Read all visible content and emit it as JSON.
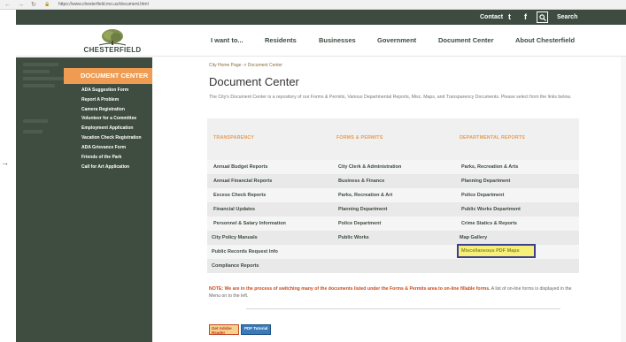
{
  "browser": {
    "back": "←",
    "forward": "→",
    "refresh": "↻",
    "lock": "🔒",
    "url": "https://www.chesterfield.mo.us/document.html"
  },
  "topbar": {
    "contact": "Contact",
    "twitter": "t",
    "facebook": "f",
    "search_label": "Search"
  },
  "site": {
    "logo_text": "CHESTERFIELD",
    "nav": [
      "I want to...",
      "Residents",
      "Businesses",
      "Government",
      "Document Center",
      "About Chesterfield"
    ]
  },
  "sidebar": {
    "title": "DOCUMENT CENTER",
    "items": [
      "ADA Suggestion Form",
      "Report A Problem",
      "Camera Registration",
      "Volunteer for a Committee",
      "Employment Application",
      "Vacation Check Registration",
      "ADA Grievance Form",
      "Friends of the Park",
      "Call for Art Application"
    ]
  },
  "main": {
    "breadcrumb_home": "City Home Page",
    "breadcrumb_sep": " -> ",
    "breadcrumb_current": "Document Center",
    "title": "Document Center",
    "intro": "The City's Document Center is a repository of our Forms & Permits, Various Departmental Reports, Misc. Maps, and Transparency Documents. Please select from the links below.",
    "columns": [
      {
        "heading": "TRANSPARENCY",
        "links": [
          "Annual Budget Reports",
          "Annual Financial Reports",
          "Excess Check Reports",
          "Financial Updates",
          "Personnel & Salary Information",
          "City Policy Manuals",
          "Public Records Request Info",
          "Compliance Reports"
        ]
      },
      {
        "heading": "FORMS & PERMITS",
        "links": [
          "City Clerk & Administration",
          "Business & Finance",
          "Parks, Recreation & Art",
          "Planning Department",
          "Police Department",
          "Public Works"
        ]
      },
      {
        "heading": "DEPARTMENTAL REPORTS",
        "links": [
          "Parks, Recreation & Arts",
          "Planning Department",
          "Police Department",
          "Public Works Department",
          "Crime Statics & Reports",
          "Map Gallery",
          "Miscellaneous PDF Maps"
        ]
      }
    ],
    "note_label": "NOTE: We are in the process of switching many of the documents listed under the Forms & Permits area to on-line fillable forms.",
    "note_text": " A list of on-line forms is displayed in the Menu on to the left.",
    "badge_adobe": "Get Adobe Reader",
    "badge_pdf": "PDF Tutorial"
  },
  "colors": {
    "dark_green": "#3d4b40",
    "orange": "#ef9c52",
    "highlight": "#f6f07a"
  }
}
